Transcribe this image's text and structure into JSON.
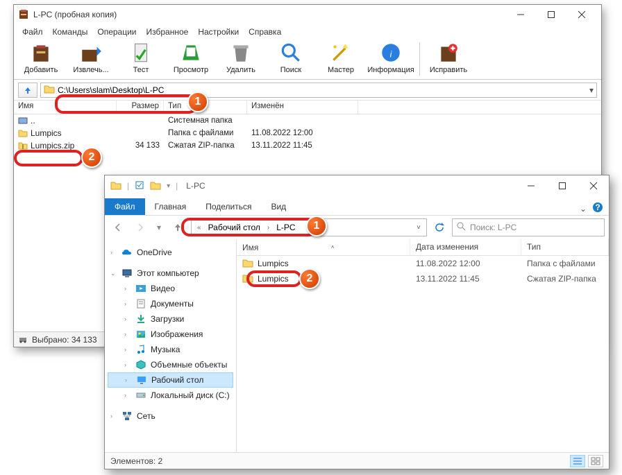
{
  "winrar": {
    "title": "L-PC (пробная копия)",
    "menu": [
      "Файл",
      "Команды",
      "Операции",
      "Избранное",
      "Настройки",
      "Справка"
    ],
    "tool": {
      "add": "Добавить",
      "extract": "Извлечь...",
      "test": "Тест",
      "view": "Просмотр",
      "delete": "Удалить",
      "find": "Поиск",
      "wizard": "Мастер",
      "info": "Информация",
      "repair": "Исправить"
    },
    "path": "C:\\Users\\slam\\Desktop\\L-PC",
    "cols": {
      "name": "Имя",
      "size": "Размер",
      "type": "Тип",
      "mod": "Изменён"
    },
    "rows": [
      {
        "name": "..",
        "size": "",
        "type": "Системная папка",
        "mod": ""
      },
      {
        "name": "Lumpics",
        "size": "",
        "type": "Папка с файлами",
        "mod": "11.08.2022 12:00"
      },
      {
        "name": "Lumpics.zip",
        "size": "34 133",
        "type": "Сжатая ZIP-папка",
        "mod": "13.11.2022 11:45"
      }
    ],
    "status": "Выбрано: 34 133"
  },
  "explorer": {
    "qat_title": "L-PC",
    "tabs": {
      "file": "Файл",
      "home": "Главная",
      "share": "Поделиться",
      "view": "Вид"
    },
    "breadcrumb": [
      "Рабочий стол",
      "L-PC"
    ],
    "search_placeholder": "Поиск: L-PC",
    "cols": {
      "name": "Имя",
      "date": "Дата изменения",
      "type": "Тип"
    },
    "rows": [
      {
        "name": "Lumpics",
        "date": "11.08.2022 12:00",
        "type": "Папка с файлами"
      },
      {
        "name": "Lumpics",
        "date": "13.11.2022 11:45",
        "type": "Сжатая ZIP-папка"
      }
    ],
    "tree": {
      "onedrive": "OneDrive",
      "thispc": "Этот компьютер",
      "video": "Видео",
      "docs": "Документы",
      "downloads": "Загрузки",
      "pictures": "Изображения",
      "music": "Музыка",
      "objects3d": "Объемные объекты",
      "desktop": "Рабочий стол",
      "cdrive": "Локальный диск (C:)",
      "network": "Сеть"
    },
    "status": "Элементов: 2"
  },
  "badges": {
    "one": "1",
    "two": "2"
  }
}
